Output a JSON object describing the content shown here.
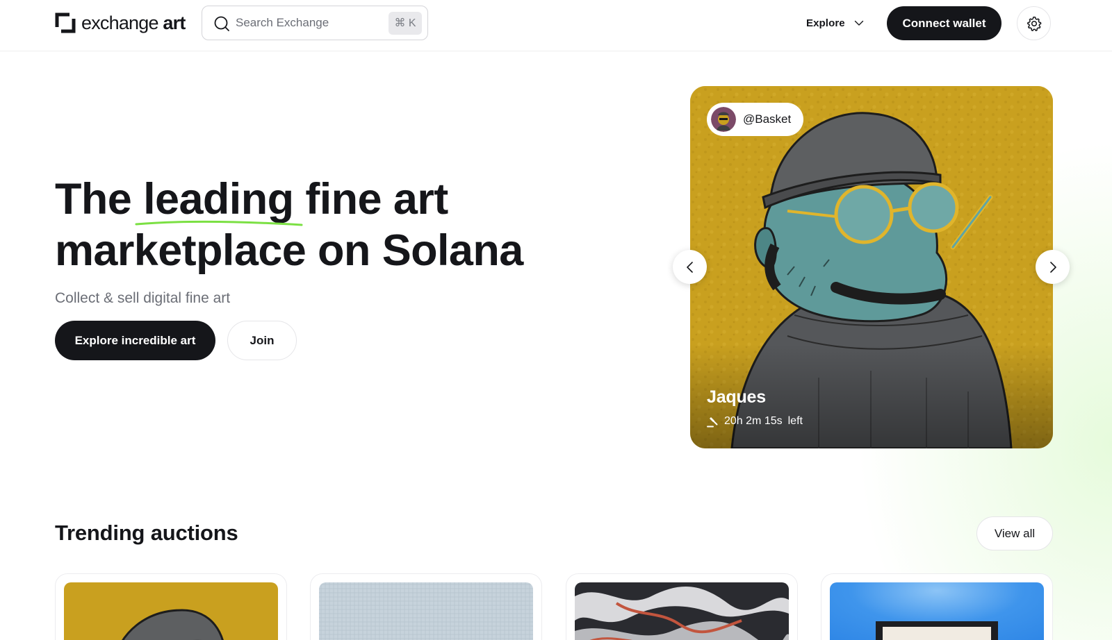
{
  "brand": {
    "logo_word": "exchange",
    "logo_word_bold": "art"
  },
  "header": {
    "search_placeholder": "Search Exchange",
    "search_shortcut": "⌘ K",
    "explore_label": "Explore",
    "connect_label": "Connect wallet",
    "icons": [
      "search-icon",
      "chevron-down-icon",
      "gear-icon"
    ]
  },
  "hero": {
    "title_before": "The",
    "title_highlight": "leading",
    "title_after": "fine art",
    "title_line2": "marketplace on Solana",
    "subtitle": "Collect & sell digital fine art",
    "primary_cta": "Explore incredible art",
    "secondary_cta": "Join",
    "underline_color": "#7be043"
  },
  "featured": {
    "artist": "@Basket",
    "title": "Jaques",
    "time_left": "20h 2m 15s",
    "time_suffix": "left",
    "icons": [
      "gavel-icon",
      "chevron-left-icon",
      "chevron-right-icon"
    ]
  },
  "trending": {
    "title": "Trending auctions",
    "view_all": "View all"
  },
  "colors": {
    "primary": "#15161a",
    "muted_text": "#6b6e76",
    "border": "#e5e5e8",
    "feature_bg": "#c9a01f"
  }
}
